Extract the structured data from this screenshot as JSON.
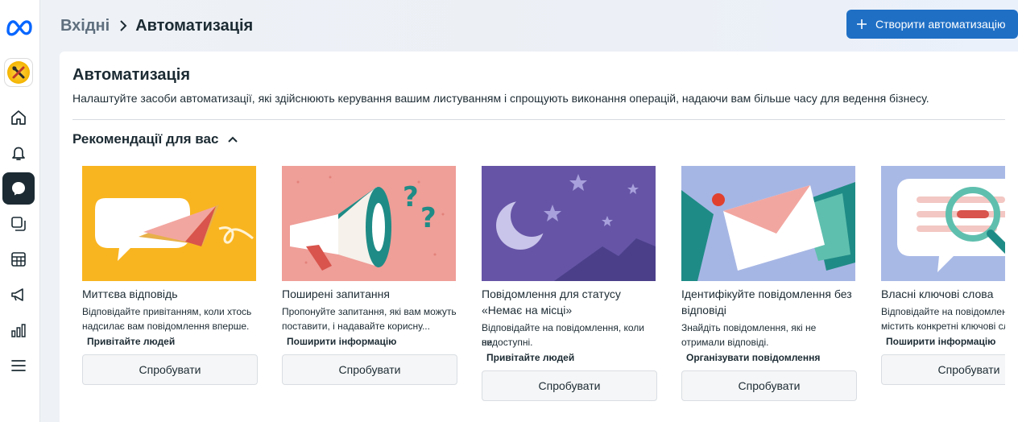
{
  "header": {
    "breadcrumb_root": "Вхідні",
    "breadcrumb_current": "Автоматизація",
    "create_button": "Створити автоматизацію"
  },
  "rail": {
    "icons": [
      "meta-logo-icon",
      "business-avatar",
      "home-icon",
      "bell-icon",
      "chat-icon",
      "pages-icon",
      "table-icon",
      "megaphone-icon",
      "insights-icon",
      "menu-icon"
    ]
  },
  "main": {
    "title": "Автоматизація",
    "description": "Налаштуйте засоби автоматизації, які здійснюють керування вашим листуванням і спрощують виконання операцій, надаючи вам більше часу для ведення бізнесу.",
    "section_title": "Рекомендації для вас",
    "cards": [
      {
        "title": "Миттєва відповідь",
        "desc_line1": "Відповідайте привітанням, коли хтось",
        "desc_line2": "надсилає вам повідомлення вперше.",
        "tag": "Привітайте людей",
        "button": "Спробувати",
        "bg": "#f9b520"
      },
      {
        "title": "Поширені запитання",
        "desc_line1": "Пропонуйте запитання, які вам можуть",
        "desc_line2": "поставити, і надавайте корисну...",
        "tag": "Поширити інформацію",
        "button": "Спробувати",
        "bg": "#ef9e98"
      },
      {
        "title_line1": "Повідомлення для статусу",
        "title_line2": "«Немає на місці»",
        "desc_line1": "Відповідайте на повідомлення, коли ви",
        "desc_line2": "недоступні.",
        "tag": "Привітайте людей",
        "button": "Спробувати",
        "bg": "#6655a6"
      },
      {
        "title_line1": "Ідентифікуйте повідомлення без",
        "title_line2": "відповіді",
        "desc_line1": "Знайдіть повідомлення, які не",
        "desc_line2": "отримали відповіді.",
        "tag": "Організувати повідомлення",
        "button": "Спробувати",
        "bg": "#a6b6e4"
      },
      {
        "title": "Власні ключові слова",
        "desc_line1": "Відповідайте на повідомлення, які",
        "desc_line2": "містить конкретні ключові сл",
        "tag": "Поширити інформацію",
        "button": "Спробувати",
        "bg": "#a8b9e6"
      }
    ]
  },
  "colors": {
    "accent": "#1f6fc5",
    "rail_active": "#1c2b33",
    "text": "#1c2b33"
  }
}
